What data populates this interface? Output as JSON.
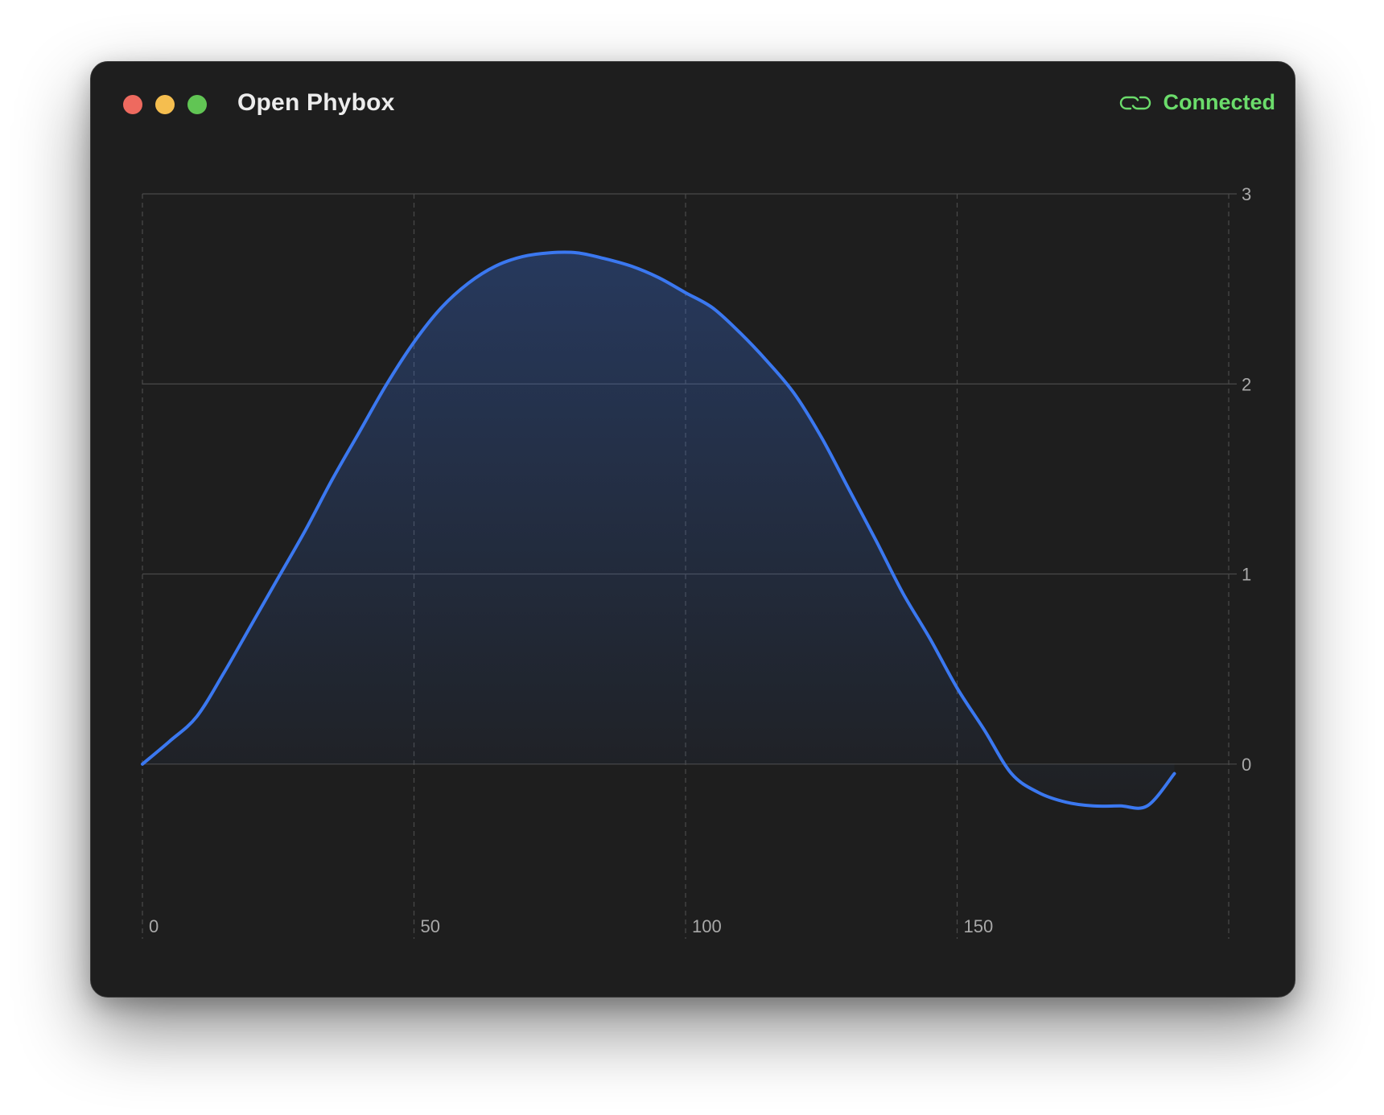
{
  "window": {
    "title": "Open Phybox",
    "status": {
      "label": "Connected",
      "icon": "link-icon",
      "color": "#6bdc6b"
    },
    "controls": [
      "close",
      "minimize",
      "zoom"
    ]
  },
  "colors": {
    "background": "#1e1e1e",
    "line": "#3b78f0",
    "grid": "#4a4a4a"
  },
  "chart_data": {
    "type": "area",
    "title": "",
    "xlabel": "",
    "ylabel": "",
    "xlim": [
      0,
      200
    ],
    "ylim": [
      -0.75,
      3
    ],
    "x_ticks": [
      "0",
      "50",
      "100",
      "150"
    ],
    "y_ticks": [
      "3",
      "2",
      "1",
      "0"
    ],
    "y_axis_position": "right",
    "grid": true,
    "series": [
      {
        "x": [
          0,
          5,
          10,
          15,
          20,
          25,
          30,
          35,
          40,
          45,
          50,
          55,
          60,
          65,
          70,
          75,
          80,
          85,
          90,
          95,
          100,
          105,
          110,
          115,
          120,
          125,
          130,
          135,
          140,
          145,
          150,
          155,
          160,
          165,
          170,
          175,
          180,
          185,
          190
        ],
        "y": [
          0,
          0.12,
          0.25,
          0.48,
          0.73,
          0.98,
          1.23,
          1.5,
          1.75,
          2.0,
          2.22,
          2.4,
          2.53,
          2.62,
          2.67,
          2.69,
          2.69,
          2.66,
          2.62,
          2.56,
          2.48,
          2.4,
          2.27,
          2.12,
          1.95,
          1.72,
          1.45,
          1.18,
          0.9,
          0.66,
          0.4,
          0.18,
          -0.05,
          -0.15,
          -0.2,
          -0.22,
          -0.22,
          -0.22,
          -0.05
        ]
      }
    ]
  }
}
